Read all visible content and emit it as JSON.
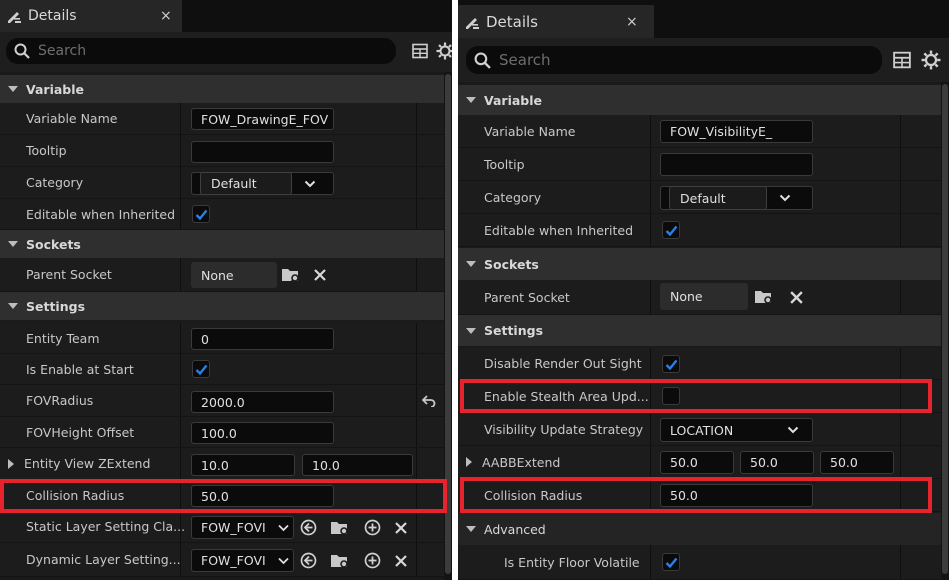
{
  "left_panel": {
    "tab": {
      "title": "Details",
      "close": "×"
    },
    "search": {
      "placeholder": "Search"
    },
    "categories": {
      "variable": "Variable",
      "sockets": "Sockets",
      "settings": "Settings"
    },
    "rows": {
      "variable_name": {
        "label": "Variable Name",
        "value": "FOW_DrawingE_FOV"
      },
      "tooltip": {
        "label": "Tooltip",
        "value": ""
      },
      "category": {
        "label": "Category",
        "value": "Default"
      },
      "editable_when_inherited": {
        "label": "Editable when Inherited",
        "checked": true
      },
      "parent_socket": {
        "label": "Parent Socket",
        "value": "None"
      },
      "entity_team": {
        "label": "Entity Team",
        "value": "0"
      },
      "is_enable_at_start": {
        "label": "Is Enable at Start",
        "checked": true
      },
      "fov_radius": {
        "label": "FOVRadius",
        "value": "2000.0"
      },
      "fov_height_offset": {
        "label": "FOVHeight Offset",
        "value": "100.0"
      },
      "entity_view_zextend": {
        "label": "Entity View ZExtend",
        "value_a": "10.0",
        "value_b": "10.0"
      },
      "collision_radius": {
        "label": "Collision Radius",
        "value": "50.0"
      },
      "static_layer": {
        "label": "Static Layer Setting Cla...",
        "value": "FOW_FOVI"
      },
      "dynamic_layer": {
        "label": "Dynamic Layer Setting...",
        "value": "FOW_FOVI"
      }
    }
  },
  "right_panel": {
    "tab": {
      "title": "Details",
      "close": "×"
    },
    "search": {
      "placeholder": "Search"
    },
    "categories": {
      "variable": "Variable",
      "sockets": "Sockets",
      "settings": "Settings",
      "advanced": "Advanced"
    },
    "rows": {
      "variable_name": {
        "label": "Variable Name",
        "value": "FOW_VisibilityE_"
      },
      "tooltip": {
        "label": "Tooltip",
        "value": ""
      },
      "category": {
        "label": "Category",
        "value": "Default"
      },
      "editable_when_inherited": {
        "label": "Editable when Inherited",
        "checked": true
      },
      "parent_socket": {
        "label": "Parent Socket",
        "value": "None"
      },
      "disable_render_out_sight": {
        "label": "Disable Render Out Sight",
        "checked": true
      },
      "enable_stealth_area": {
        "label": "Enable Stealth Area Upd...",
        "checked": false
      },
      "visibility_update_strategy": {
        "label": "Visibility Update Strategy",
        "value": "LOCATION"
      },
      "aabb_extend": {
        "label": "AABBExtend",
        "x": "50.0",
        "y": "50.0",
        "z": "50.0"
      },
      "collision_radius": {
        "label": "Collision Radius",
        "value": "50.0"
      },
      "is_entity_floor_volatile": {
        "label": "Is Entity Floor Volatile",
        "checked": true
      }
    }
  },
  "colors": {
    "highlight": "#e8232d",
    "checkbox_accent": "#1f6fd1",
    "background": "#1a1a1a"
  }
}
